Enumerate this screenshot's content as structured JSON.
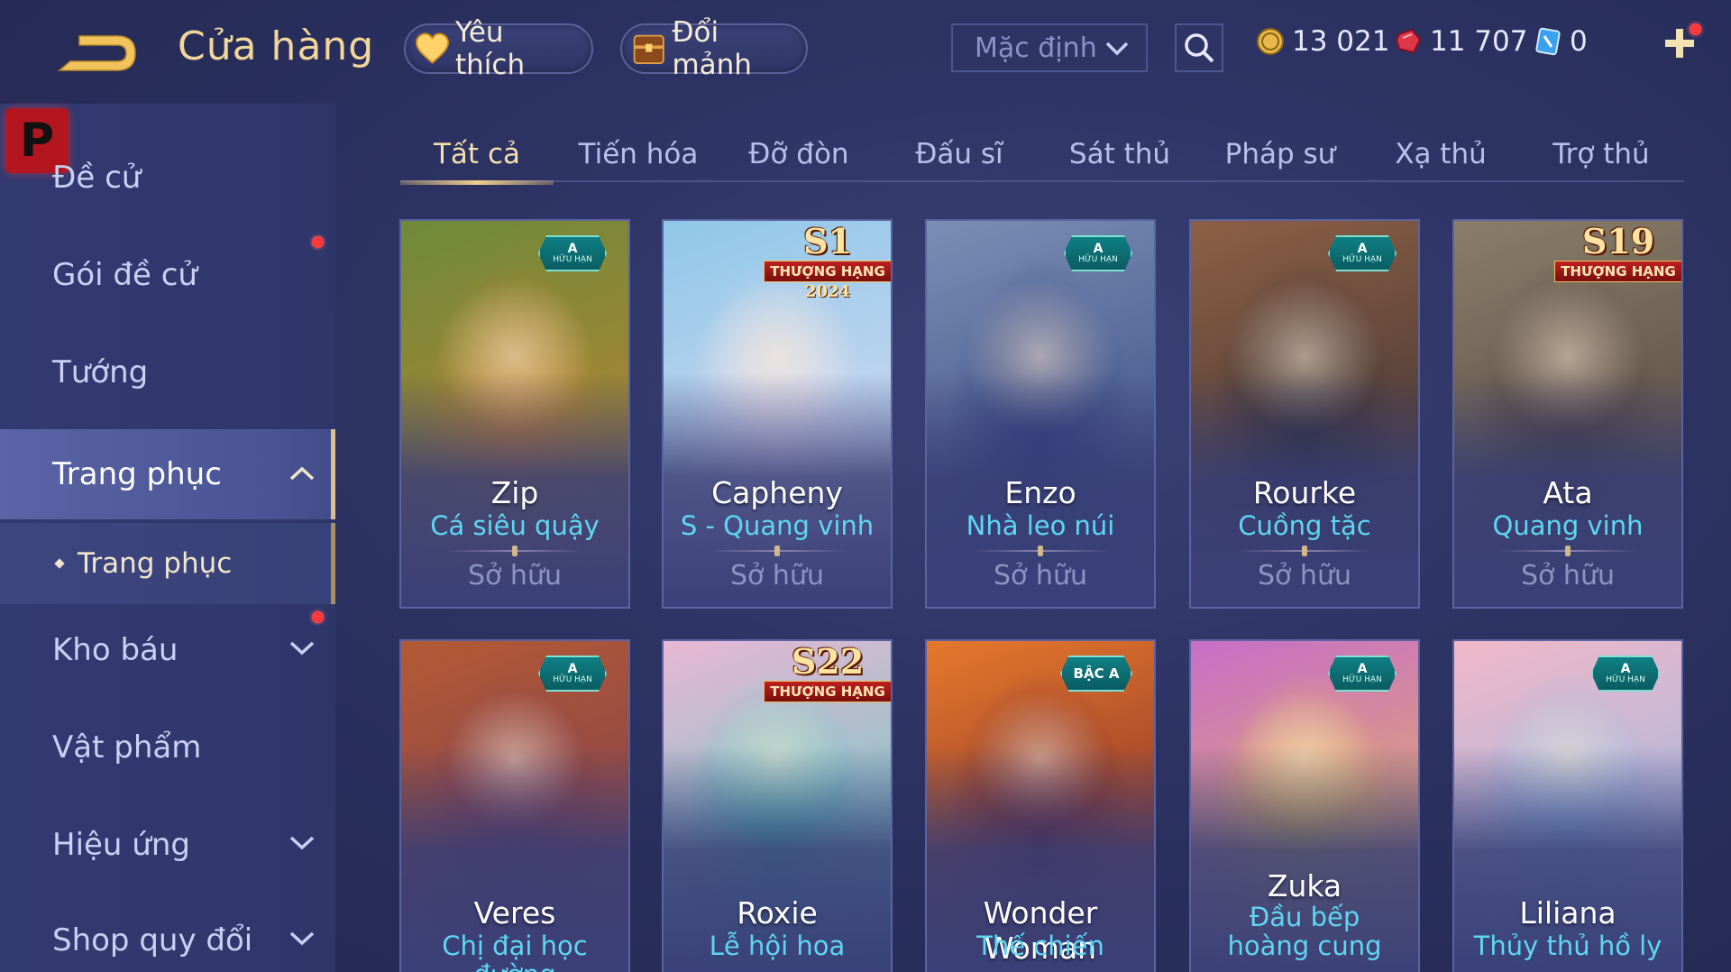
{
  "header": {
    "title": "Cửa hàng",
    "favorite_label": "Yêu thích",
    "fragment_label": "Đổi mảnh",
    "sort_selected": "Mặc định"
  },
  "currencies": {
    "gold": "13 021",
    "ruby": "11 707",
    "voucher": "0"
  },
  "sidebar": {
    "items": [
      {
        "label": "Đề cử"
      },
      {
        "label": "Gói đề cử"
      },
      {
        "label": "Tướng"
      },
      {
        "label": "Trang phục"
      },
      {
        "label": "Kho báu"
      },
      {
        "label": "Vật phẩm"
      },
      {
        "label": "Hiệu ứng"
      },
      {
        "label": "Shop quy đổi"
      }
    ],
    "sub_item": "Trang phục",
    "logo_letter": "P"
  },
  "tabs": [
    "Tất cả",
    "Tiến hóa",
    "Đỡ đòn",
    "Đấu sĩ",
    "Sát thủ",
    "Pháp sư",
    "Xạ thủ",
    "Trợ thủ"
  ],
  "cards": [
    {
      "hero": "Zip",
      "skin": "Cá siêu quậy",
      "status": "Sở hữu",
      "badge_rank": "A",
      "badge_text": "HỮU HẠN",
      "bg1": "#6e8a3a",
      "bg2": "#c9822e",
      "icon": "zip-skin-portrait"
    },
    {
      "hero": "Capheny",
      "skin": "S - Quang vinh",
      "status": "Sở hữu",
      "season": "S1",
      "season_label": "THƯỢNG HẠNG",
      "season_year": "2024",
      "bg1": "#8fc7e8",
      "bg2": "#e8e0f4",
      "icon": "capheny-skin-portrait"
    },
    {
      "hero": "Enzo",
      "skin": "Nhà leo núi",
      "status": "Sở hữu",
      "badge_rank": "A",
      "badge_text": "HỮU HẠN",
      "bg1": "#7a8eb4",
      "bg2": "#2f3f7c",
      "icon": "enzo-skin-portrait"
    },
    {
      "hero": "Rourke",
      "skin": "Cuồng tặc",
      "status": "Sở hữu",
      "badge_rank": "A",
      "badge_text": "HỮU HẠN",
      "bg1": "#8d6046",
      "bg2": "#2f2a2e",
      "icon": "rourke-skin-portrait"
    },
    {
      "hero": "Ata",
      "skin": "Quang vinh",
      "status": "Sở hữu",
      "season": "S19",
      "season_label": "THƯỢNG HẠNG",
      "bg1": "#8a7e6a",
      "bg2": "#4a3c36",
      "icon": "ata-skin-portrait"
    },
    {
      "hero": "Veres",
      "skin": "Chị đại học đường",
      "badge_rank": "A",
      "badge_text": "HỮU HẠN",
      "bg1": "#b35a36",
      "bg2": "#7a3a52",
      "icon": "veres-skin-portrait"
    },
    {
      "hero": "Roxie",
      "skin": "Lễ hội hoa",
      "season": "S22",
      "season_label": "THƯỢNG HẠNG",
      "bg1": "#e8b8d4",
      "bg2": "#4fc9c2",
      "icon": "roxie-skin-portrait"
    },
    {
      "hero": "Wonder Woman",
      "skin": "Thế chiến",
      "badge_rank": "BẬC A",
      "bg1": "#e6782c",
      "bg2": "#6c1e2a",
      "icon": "wonder-woman-skin-portrait"
    },
    {
      "hero": "Zuka",
      "skin": "Đầu bếp hoàng cung",
      "badge_rank": "A",
      "badge_text": "HỮU HẠN",
      "bg1": "#c86ec8",
      "bg2": "#e8c04a",
      "icon": "zuka-skin-portrait"
    },
    {
      "hero": "Liliana",
      "skin": "Thủy thủ hồ ly",
      "badge_rank": "A",
      "badge_text": "HỮU HẠN",
      "bg1": "#f0b8c8",
      "bg2": "#8ab8e8",
      "icon": "liliana-skin-portrait"
    }
  ],
  "colors": {
    "accent_gold": "#f2d79a",
    "skin_name": "#5fd6f2",
    "notification": "#ff3a3a"
  }
}
